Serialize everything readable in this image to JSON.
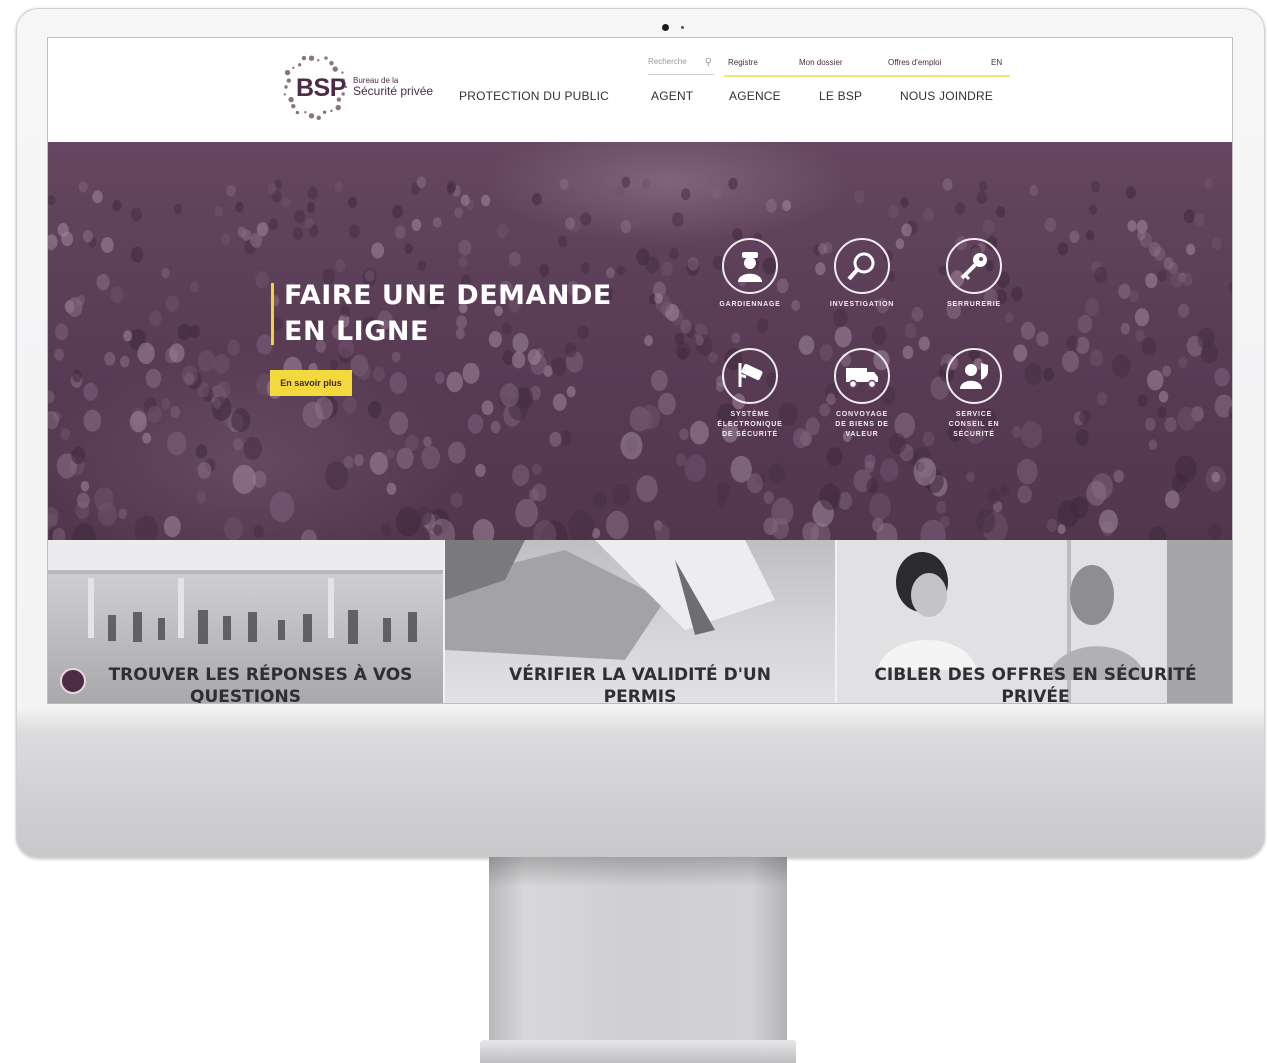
{
  "header": {
    "logo": {
      "abbr": "BSP",
      "line1": "Bureau de la",
      "line2": "Sécurité privée"
    },
    "search": {
      "placeholder": "Recherche"
    },
    "util_links": [
      "Registre",
      "Mon dossier",
      "Offres d'emploi",
      "EN"
    ],
    "nav": [
      "PROTECTION DU PUBLIC",
      "AGENT",
      "AGENCE",
      "LE BSP",
      "NOUS JOINDRE"
    ]
  },
  "hero": {
    "title_line1": "FAIRE UNE DEMANDE",
    "title_line2": "EN LIGNE",
    "button": "En savoir plus",
    "services": [
      {
        "label": "GARDIENNAGE",
        "icon": "guard-icon"
      },
      {
        "label": "INVESTIGATION",
        "icon": "magnifier-icon"
      },
      {
        "label": "SERRURERIE",
        "icon": "key-icon"
      },
      {
        "label_lines": [
          "SYSTÈME",
          "ÉLECTRONIQUE",
          "DE SÉCURITÉ"
        ],
        "icon": "camera-icon"
      },
      {
        "label_lines": [
          "CONVOYAGE",
          "DE BIENS DE",
          "VALEUR"
        ],
        "icon": "truck-icon"
      },
      {
        "label_lines": [
          "SERVICE",
          "CONSEIL EN",
          "SÉCURITÉ"
        ],
        "icon": "consultant-icon"
      }
    ]
  },
  "cards": [
    {
      "line1": "TROUVER LES RÉPONSES À VOS",
      "line2": "QUESTIONS"
    },
    {
      "line1": "VÉRIFIER LA VALIDITÉ D'UN",
      "line2": "PERMIS"
    },
    {
      "line1": "CIBLER DES OFFRES EN SÉCURITÉ",
      "line2": "PRIVÉE"
    }
  ],
  "colors": {
    "brand_purple": "#4b2b46",
    "accent_yellow": "#f3d93d",
    "hero_tint": "#5f4159"
  }
}
